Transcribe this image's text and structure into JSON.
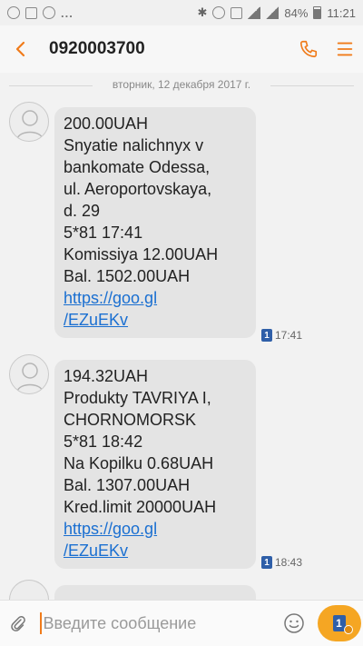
{
  "status_bar": {
    "battery": "84%",
    "time": "11:21"
  },
  "header": {
    "title": "0920003700"
  },
  "date_separator": "вторник, 12 декабря 2017 г.",
  "messages": [
    {
      "lines": [
        "200.00UAH",
        "Snyatie nalichnyx v",
        "bankomate Odessa,",
        "ul. Aeroportovskaya,",
        "d. 29",
        "5*81 17:41",
        "Komissiya 12.00UAH",
        "Bal. 1502.00UAH"
      ],
      "link_lines": [
        "https://goo.gl",
        "/EZuEKv"
      ],
      "sim": "1",
      "time": "17:41"
    },
    {
      "lines": [
        "194.32UAH",
        "Produkty TAVRIYA I,",
        "CHORNOMORSK",
        "5*81 18:42",
        "Na Kopilku 0.68UAH",
        "Bal. 1307.00UAH",
        "Kred.limit 20000UAH"
      ],
      "link_lines": [
        "https://goo.gl",
        "/EZuEKv"
      ],
      "sim": "1",
      "time": "18:43"
    }
  ],
  "composer": {
    "placeholder": "Введите сообщение",
    "send_sim": "1"
  },
  "colors": {
    "accent": "#f07b1a",
    "bubble": "#e4e4e4",
    "link": "#1a6fd1",
    "sim": "#2f5fa8",
    "send": "#f5a623"
  }
}
